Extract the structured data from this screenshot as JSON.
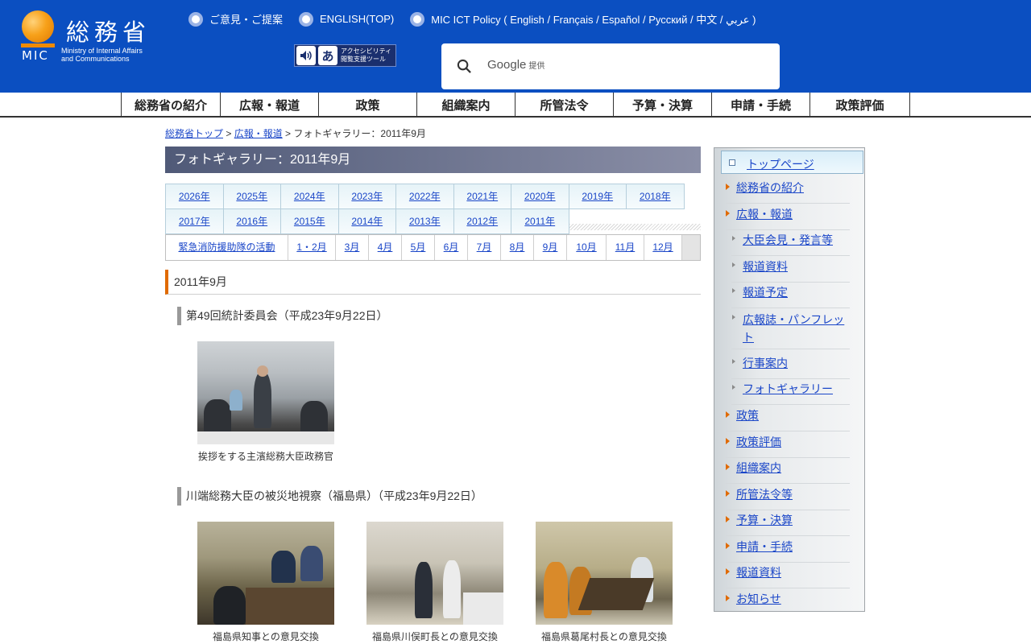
{
  "header": {
    "logo_kanji": "総務省",
    "logo_mic": "MIC",
    "logo_ministry_line1": "Ministry of Internal Affairs",
    "logo_ministry_line2": "and Communications",
    "top_links": [
      "ご意見・ご提案",
      "ENGLISH(TOP)",
      "MIC ICT Policy ( English / Français / Español / Русский / 中文 / عربي )"
    ],
    "access_tool_line1": "アクセシビリティ",
    "access_tool_line2": "閲覧支援ツール",
    "access_tool_glyph": "あ",
    "search_brand": "Google",
    "search_brand_suffix": "提供"
  },
  "gnav": [
    "総務省の紹介",
    "広報・報道",
    "政策",
    "組織案内",
    "所管法令",
    "予算・決算",
    "申請・手続",
    "政策評価"
  ],
  "breadcrumb": {
    "home": "総務省トップ",
    "sep1": " > ",
    "section": "広報・報道",
    "sep2": " > ",
    "current": "フォトギャラリー：2011年9月"
  },
  "page_title": "フォトギャラリー：2011年9月",
  "year_tabs_row1": [
    "2026年",
    "2025年",
    "2024年",
    "2023年",
    "2022年",
    "2021年",
    "2020年",
    "2019年",
    "2018年"
  ],
  "year_tabs_row2": [
    "2017年",
    "2016年",
    "2015年",
    "2014年",
    "2013年",
    "2012年",
    "2011年"
  ],
  "month_links": [
    "緊急消防援助隊の活動",
    "1・2月",
    "3月",
    "4月",
    "5月",
    "6月",
    "7月",
    "8月",
    "9月",
    "10月",
    "11月",
    "12月"
  ],
  "section_heading": "2011年9月",
  "events": [
    {
      "title": "第49回統計委員会（平成23年9月22日）",
      "photos": [
        {
          "caption": "挨拶をする主濱総務大臣政務官"
        }
      ]
    },
    {
      "title": "川端総務大臣の被災地視察（福島県）（平成23年9月22日）",
      "photos": [
        {
          "caption": "福島県知事との意見交換"
        },
        {
          "caption": "福島県川俣町長との意見交換"
        },
        {
          "caption": "福島県葛尾村長との意見交換"
        }
      ]
    }
  ],
  "sidebar": {
    "top": "トップページ",
    "items": [
      {
        "label": "総務省の紹介",
        "level": 1
      },
      {
        "label": "広報・報道",
        "level": 1
      },
      {
        "label": "大臣会見・発言等",
        "level": 2
      },
      {
        "label": "報道資料",
        "level": 2
      },
      {
        "label": "報道予定",
        "level": 2
      },
      {
        "label": "広報誌・パンフレット",
        "level": 2
      },
      {
        "label": "行事案内",
        "level": 2
      },
      {
        "label": "フォトギャラリー",
        "level": 2
      },
      {
        "label": "政策",
        "level": 1
      },
      {
        "label": "政策評価",
        "level": 1
      },
      {
        "label": "組織案内",
        "level": 1
      },
      {
        "label": "所管法令等",
        "level": 1
      },
      {
        "label": "予算・決算",
        "level": 1
      },
      {
        "label": "申請・手続",
        "level": 1
      },
      {
        "label": "報道資料",
        "level": 1
      },
      {
        "label": "お知らせ",
        "level": 1
      }
    ]
  },
  "colors": {
    "header_blue": "#0b4fc1",
    "link_blue": "#1a46c8",
    "accent_orange": "#e06a00"
  }
}
